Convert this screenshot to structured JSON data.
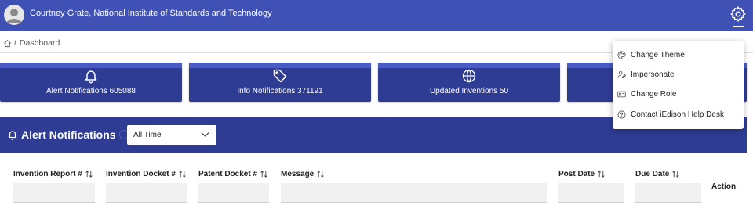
{
  "header": {
    "user_name": "Courtney Grate, National Institute of Standards and Technology",
    "avatar_icon": "user-avatar-icon",
    "settings_icon": "gear-icon",
    "bg_color": "#3f51b5"
  },
  "breadcrumb": {
    "home_icon": "home-icon",
    "separator": "/",
    "current": "Dashboard"
  },
  "stats": [
    {
      "icon": "bell-icon",
      "label": "Alert Notifications 605088"
    },
    {
      "icon": "tag-icon",
      "label": "Info Notifications 371191"
    },
    {
      "icon": "globe-icon",
      "label": "Updated Inventions 50"
    },
    {
      "icon": "",
      "label": ""
    }
  ],
  "alerts": {
    "title": "Alert Notifications",
    "title_icon": "bell-icon",
    "time_filter": {
      "value": "All Time"
    },
    "columns": [
      {
        "label": "Invention Report #"
      },
      {
        "label": "Invention Docket #"
      },
      {
        "label": "Patent Docket #"
      },
      {
        "label": "Message"
      },
      {
        "label": "Post Date"
      },
      {
        "label": "Due Date"
      }
    ],
    "action_label": "Action"
  },
  "settings_menu": {
    "items": [
      {
        "label": "Change Theme",
        "icon": "palette-icon"
      },
      {
        "label": "Impersonate",
        "icon": "user-pen-icon"
      },
      {
        "label": "Change Role",
        "icon": "id-card-icon"
      },
      {
        "label": "Contact iEdison Help Desk",
        "icon": "help-circle-icon"
      }
    ]
  },
  "colors": {
    "primary": "#3f51b5",
    "card": "#2f3c94",
    "card_strip": "#4a5bc4"
  }
}
